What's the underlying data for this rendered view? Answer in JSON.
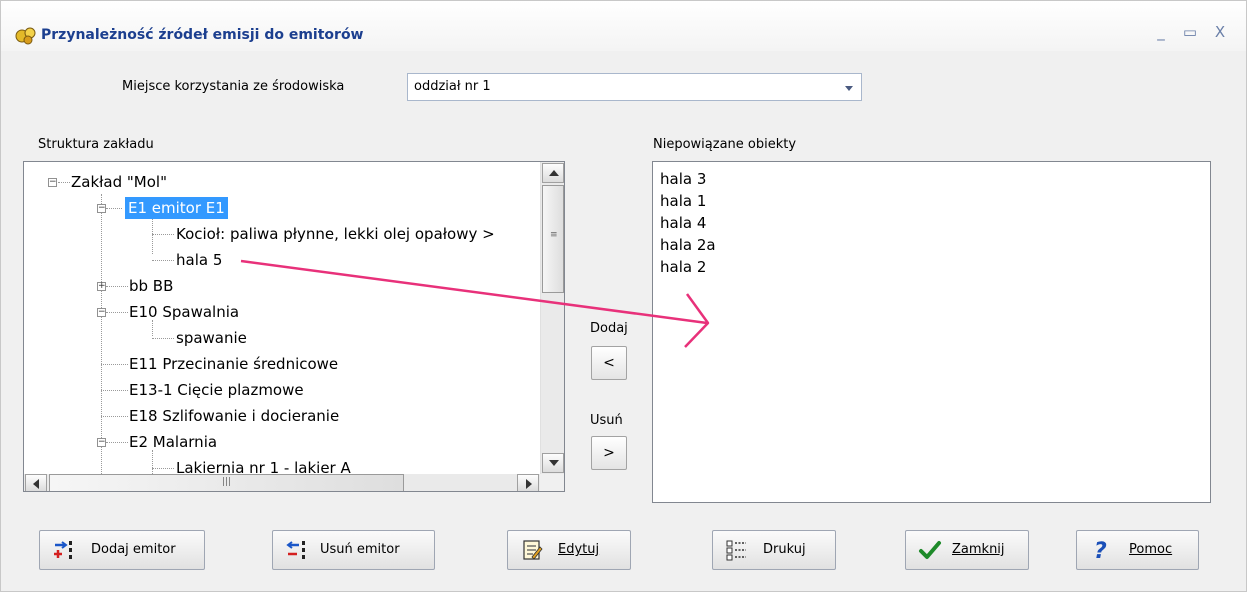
{
  "window": {
    "title": "Przynależność źródeł emisji do emitorów",
    "controls": {
      "minimize": "_",
      "maximize": "▭",
      "close": "X"
    }
  },
  "location": {
    "label": "Miejsce korzystania ze środowiska",
    "value": "oddział nr 1"
  },
  "tree": {
    "label": "Struktura zakładu",
    "nodes": [
      {
        "label": "Zakład \"Mol\"",
        "expander": "⊟"
      },
      {
        "label": "E1 emitor E1",
        "expander": "⊟",
        "selected": true
      },
      {
        "label": "Kocioł: paliwa płynne, lekki olej opałowy >"
      },
      {
        "label": "hala 5"
      },
      {
        "label": "bb BB",
        "expander": "⊞"
      },
      {
        "label": "E10 Spawalnia",
        "expander": "⊟"
      },
      {
        "label": "spawanie"
      },
      {
        "label": "E11 Przecinanie średnicowe"
      },
      {
        "label": "E13-1 Cięcie plazmowe"
      },
      {
        "label": "E18 Szlifowanie i docieranie"
      },
      {
        "label": "E2 Malarnia",
        "expander": "⊟"
      },
      {
        "label": "Lakiernia nr 1 - lakier A"
      }
    ]
  },
  "unlinked": {
    "label": "Niepowiązane obiekty",
    "items": [
      "hala 3",
      "hala 1",
      "hala 4",
      "hala 2a",
      "hala 2"
    ]
  },
  "transfer": {
    "add_label": "Dodaj",
    "add_button": "<",
    "remove_label": "Usuń",
    "remove_button": ">"
  },
  "buttons": {
    "add_emitter": "Dodaj emitor",
    "remove_emitter": "Usuń emitor",
    "edit": "Edytuj",
    "print": "Drukuj",
    "close": "Zamknij",
    "help": "Pomoc"
  },
  "colors": {
    "selection": "#3399ff",
    "annotation_arrow": "#e8317a",
    "title_text": "#1c3f8f"
  }
}
